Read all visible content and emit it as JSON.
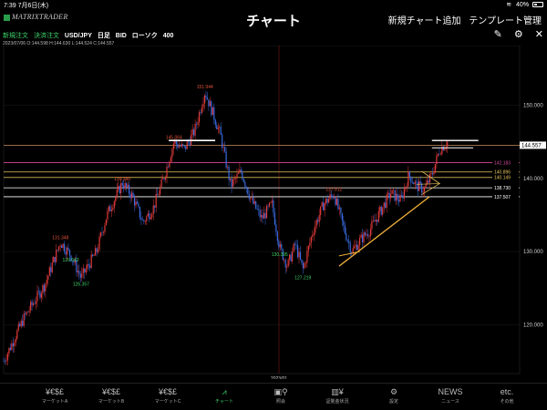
{
  "status": {
    "time": "7:39",
    "date": "7月6日(木)",
    "battery": "40%",
    "battery_level": 0.4
  },
  "header": {
    "logo": "MATRIXTRADER",
    "title": "チャート",
    "add_chart": "新規チャート追加",
    "template": "テンプレート管理"
  },
  "toolbar": {
    "new_order": "新規注文",
    "settle_order": "決済注文",
    "pair": "USD/JPY",
    "period": "日足",
    "side": "BID",
    "candle": "ローソク",
    "count": "400"
  },
  "ohlc": "2023/07/06 O:144.598 H:144.630 L:144.524 C:144.557",
  "icons": {
    "pencil": "pencil-icon",
    "gear": "gear-icon",
    "close": "close-icon"
  },
  "chart_data": {
    "type": "candlestick",
    "y_range": [
      113.3,
      158.2
    ],
    "y_ticks": [
      "150.000",
      "140.000",
      "130.000",
      "120.000"
    ],
    "y_tick_values": [
      150,
      140,
      130,
      120
    ],
    "x_label": "2023/01",
    "current_price": "144.557",
    "current_value": 144.557,
    "annotations": [
      {
        "text": "151.944",
        "value": 151.944,
        "color": "#e0533a"
      },
      {
        "text": "139.390",
        "value": 139.39,
        "color": "#e0533a"
      },
      {
        "text": "131.348",
        "value": 131.348,
        "color": "#e0533a"
      },
      {
        "text": "126.357",
        "value": 126.357,
        "color": "#3fd46b"
      },
      {
        "text": "130.395",
        "value": 130.395,
        "color": "#3fd46b"
      },
      {
        "text": "127.219",
        "value": 127.219,
        "color": "#3fd46b"
      },
      {
        "text": "137.912",
        "value": 137.912,
        "color": "#e0533a"
      },
      {
        "text": "129.642",
        "value": 129.642,
        "color": "#3fd46b"
      },
      {
        "text": "145.064",
        "value": 145.064,
        "color": "#e0533a"
      }
    ],
    "horizontal_lines": [
      {
        "value": 144.557,
        "color": "#c89060",
        "label": "144.557"
      },
      {
        "value": 142.183,
        "color": "#d6479e",
        "label": "142.183"
      },
      {
        "value": 140.896,
        "color": "#e8c55a",
        "label": "140.896"
      },
      {
        "value": 140.149,
        "color": "#e8c55a",
        "label": "140.149"
      },
      {
        "value": 138.73,
        "color": "#ffffff",
        "label": "138.730"
      },
      {
        "value": 137.507,
        "color": "#ffffff",
        "label": "137.507"
      }
    ],
    "close_path": [
      [
        0.0,
        115.0
      ],
      [
        0.04,
        121.0
      ],
      [
        0.08,
        125.5
      ],
      [
        0.11,
        131.3
      ],
      [
        0.13,
        129.5
      ],
      [
        0.15,
        126.4
      ],
      [
        0.18,
        130.0
      ],
      [
        0.2,
        135.0
      ],
      [
        0.23,
        139.4
      ],
      [
        0.25,
        137.5
      ],
      [
        0.27,
        134.0
      ],
      [
        0.29,
        136.0
      ],
      [
        0.31,
        140.0
      ],
      [
        0.33,
        145.0
      ],
      [
        0.35,
        144.0
      ],
      [
        0.37,
        146.5
      ],
      [
        0.39,
        151.9
      ],
      [
        0.405,
        149.0
      ],
      [
        0.42,
        146.0
      ],
      [
        0.44,
        139.0
      ],
      [
        0.46,
        141.0
      ],
      [
        0.48,
        137.0
      ],
      [
        0.5,
        134.5
      ],
      [
        0.52,
        136.5
      ],
      [
        0.535,
        130.5
      ],
      [
        0.55,
        128.0
      ],
      [
        0.565,
        131.0
      ],
      [
        0.58,
        127.5
      ],
      [
        0.6,
        133.0
      ],
      [
        0.62,
        136.5
      ],
      [
        0.64,
        137.9
      ],
      [
        0.66,
        133.0
      ],
      [
        0.675,
        130.0
      ],
      [
        0.69,
        131.5
      ],
      [
        0.71,
        133.0
      ],
      [
        0.73,
        135.5
      ],
      [
        0.75,
        138.0
      ],
      [
        0.77,
        137.0
      ],
      [
        0.785,
        140.5
      ],
      [
        0.8,
        139.0
      ],
      [
        0.815,
        138.5
      ],
      [
        0.83,
        140.5
      ],
      [
        0.845,
        144.0
      ],
      [
        0.86,
        145.0
      ]
    ]
  },
  "tabs": [
    {
      "icon": "¥€$£",
      "label": "マーケットA",
      "active": false
    },
    {
      "icon": "¥€$£",
      "label": "マーケットB",
      "active": false
    },
    {
      "icon": "¥€$£",
      "label": "マーケットC",
      "active": false
    },
    {
      "icon": "chart-icon",
      "label": "チャート",
      "active": true
    },
    {
      "icon": "search-icon",
      "label": "照会",
      "active": false
    },
    {
      "icon": "bars-icon",
      "label": "証拠金状況",
      "active": false
    },
    {
      "icon": "gear-icon",
      "label": "設定",
      "active": false
    },
    {
      "icon": "NEWS",
      "label": "ニュース",
      "active": false
    },
    {
      "icon": "etc.",
      "label": "その他",
      "active": false
    }
  ]
}
